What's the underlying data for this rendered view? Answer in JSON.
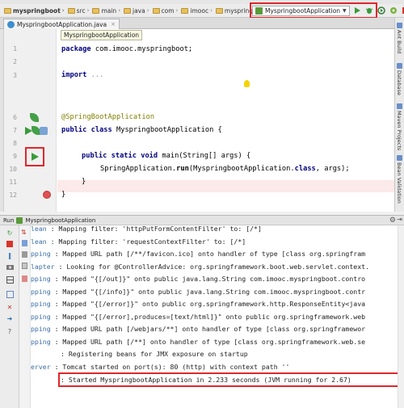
{
  "navbar": {
    "crumbs": [
      "myspringboot",
      "src",
      "main",
      "java",
      "com",
      "imooc",
      "myspringboot",
      "My"
    ],
    "run_config": "MyspringbootApplication"
  },
  "editor": {
    "tab_label": "MyspringbootApplication.java",
    "tooltip": "MyspringbootApplication",
    "line_numbers": [
      "1",
      "2",
      "3",
      "",
      "6",
      "7",
      "8",
      "9",
      "10",
      "11",
      "12"
    ],
    "lines": {
      "l1_kw": "package",
      "l1_rest": " com.imooc.myspringboot;",
      "l3_kw": "import",
      "l3_rest": " ...",
      "l6": "@SpringBootApplication",
      "l7_kw": "public class",
      "l7_rest": " MyspringbootApplication {",
      "l9_kw": "public static void",
      "l9_rest": " main(String[] args) {",
      "l10_a": "SpringApplication.",
      "l10_b": "run",
      "l10_c": "(MyspringbootApplication.",
      "l10_d": "class",
      "l10_e": ", args);",
      "l11": "}",
      "l12": "}"
    }
  },
  "right_tools": [
    "Ant Build",
    "Database",
    "Maven Projects",
    "Bean Validation"
  ],
  "run_panel": {
    "title": "Run",
    "config": "MyspringbootApplication",
    "console": [
      {
        "src": "lean ",
        "msg": ": Mapping filter: 'httpPutFormContentFilter' to: [/*]"
      },
      {
        "src": "lean ",
        "msg": ": Mapping filter: 'requestContextFilter' to: [/*]"
      },
      {
        "src": "pping ",
        "msg": ": Mapped URL path [/**/favicon.ico] onto handler of type [class org.springfram"
      },
      {
        "src": "lapter ",
        "msg": ": Looking for @ControllerAdvice: org.springframework.boot.web.servlet.context."
      },
      {
        "src": "pping ",
        "msg": ": Mapped \"{[/out]}\" onto public java.lang.String com.imooc.myspringboot.contro"
      },
      {
        "src": "pping ",
        "msg": ": Mapped \"{[/info]}\" onto public java.lang.String com.imooc.myspringboot.contr"
      },
      {
        "src": "pping ",
        "msg": ": Mapped \"{[/error]}\" onto public org.springframework.http.ResponseEntity<java"
      },
      {
        "src": "pping ",
        "msg": ": Mapped \"{[/error],produces=[text/html]}\" onto public org.springframework.web"
      },
      {
        "src": "pping ",
        "msg": ": Mapped URL path [/webjars/**] onto handler of type [class org.springframewor"
      },
      {
        "src": "pping ",
        "msg": ": Mapped URL path [/**] onto handler of type [class org.springframework.web.se"
      },
      {
        "src": "",
        "msg": ": Registering beans for JMX exposure on startup"
      },
      {
        "src": "erver ",
        "msg": ": Tomcat started on port(s): 80 (http) with context path ''"
      },
      {
        "src": "",
        "msg": ": Started MyspringbootApplication in 2.233 seconds (JVM running for 2.67)"
      }
    ]
  },
  "colors": {
    "highlight_box": "#e0262c",
    "keyword": "#000080",
    "annotation": "#808000",
    "run_icon": "#3a9a3a",
    "breakpoint": "#e05252"
  }
}
